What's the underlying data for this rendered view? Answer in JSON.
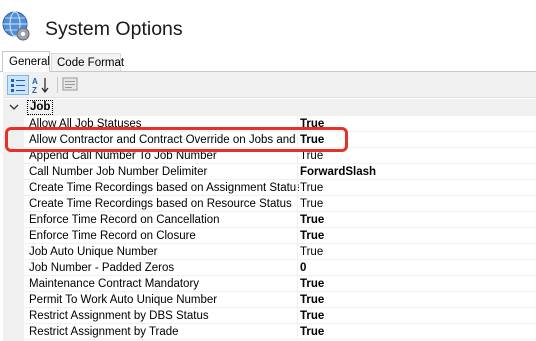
{
  "window": {
    "title": "System Options"
  },
  "tabs": [
    {
      "label": "General",
      "active": true
    },
    {
      "label": "Code Format",
      "active": false
    }
  ],
  "toolbar": {
    "icons": [
      "categorized-icon",
      "sort-alphabetical-icon",
      "property-pages-icon"
    ],
    "alpha_glyph": "A",
    "z_glyph": "Z"
  },
  "category": {
    "label": "Job",
    "expanded": true
  },
  "rows": [
    {
      "name": "Allow All Job Statuses",
      "value": "True",
      "bold": true
    },
    {
      "name": "Allow Contractor and Contract Override on Jobs and Ord",
      "value": "True",
      "bold": true
    },
    {
      "name": "Append Call Number To Job Number",
      "value": "True",
      "bold": false
    },
    {
      "name": "Call Number Job Number Delimiter",
      "value": "ForwardSlash",
      "bold": true
    },
    {
      "name": "Create Time Recordings based on Assignment Status",
      "value": "True",
      "bold": false
    },
    {
      "name": "Create Time Recordings based on Resource Status",
      "value": "True",
      "bold": false
    },
    {
      "name": "Enforce Time Record on Cancellation",
      "value": "True",
      "bold": true
    },
    {
      "name": "Enforce Time Record on Closure",
      "value": "True",
      "bold": true
    },
    {
      "name": "Job Auto Unique Number",
      "value": "True",
      "bold": false
    },
    {
      "name": "Job Number - Padded Zeros",
      "value": "0",
      "bold": true
    },
    {
      "name": "Maintenance Contract Mandatory",
      "value": "True",
      "bold": true
    },
    {
      "name": "Permit To Work Auto Unique Number",
      "value": "True",
      "bold": true
    },
    {
      "name": "Restrict Assignment by DBS Status",
      "value": "True",
      "bold": true
    },
    {
      "name": "Restrict Assignment by Trade",
      "value": "True",
      "bold": true
    }
  ],
  "colors": {
    "highlight_border": "#e8302a",
    "gutter": "#f0f0f0",
    "toolbar_selected": "#cce4f7"
  }
}
